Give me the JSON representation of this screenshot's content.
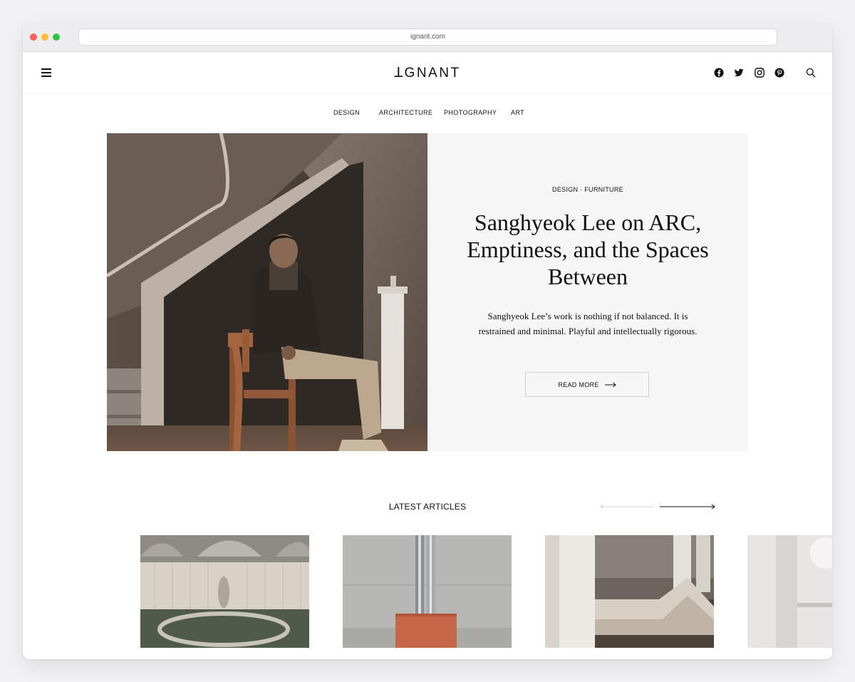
{
  "browser": {
    "url": "ignant.com"
  },
  "header": {
    "logo": "ꓕGNANT",
    "menu_icon": "hamburger-icon",
    "social_icons": [
      "facebook-icon",
      "twitter-icon",
      "instagram-icon",
      "pinterest-icon"
    ],
    "search_icon": "search-icon"
  },
  "nav": {
    "items": [
      "DESIGN",
      "ARCHITECTURE",
      "PHOTOGRAPHY",
      "ART"
    ]
  },
  "hero": {
    "category": "DESIGN · FURNITURE",
    "title": "Sanghyeok Lee on ARC, Emptiness, and the Spaces Between",
    "description": "Sanghyeok Lee’s work is nothing if not balanced. It is restrained and minimal. Playful and intellectually rigorous.",
    "cta_label": "READ MORE"
  },
  "latest": {
    "title": "LATEST ARTICLES"
  },
  "colors": {
    "background": "#f2f2f4",
    "hero_panel": "#f6f6f6",
    "text": "#111111",
    "border": "#cfcfcf"
  }
}
